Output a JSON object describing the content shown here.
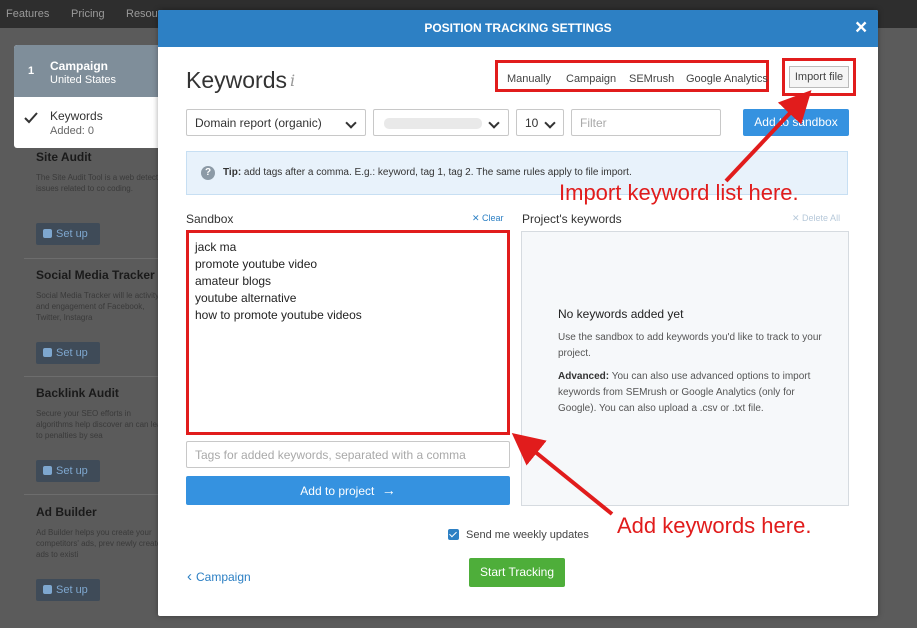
{
  "topnav": [
    "Features",
    "Pricing",
    "Resou"
  ],
  "steps": [
    {
      "num": "1",
      "title": "Campaign",
      "sub": "United States"
    },
    {
      "title": "Keywords",
      "sub": "Added: 0"
    }
  ],
  "tools": [
    {
      "title": "Site Audit",
      "desc": "The Site Audit Tool is a web detects issues related to co coding.",
      "setup": "Set up"
    },
    {
      "title": "Social Media Tracker",
      "desc": "Social Media Tracker will le activity and engagement of Facebook, Twitter, Instagra",
      "setup": "Set up"
    },
    {
      "title": "Backlink Audit",
      "desc": "Secure your SEO efforts in algorithms help discover an can lead to penalties by sea",
      "setup": "Set up"
    },
    {
      "title": "Ad Builder",
      "desc": "Ad Builder helps you create your competitors' ads, prev newly created ads to existi",
      "setup": "Set up"
    }
  ],
  "modal": {
    "title": "POSITION TRACKING SETTINGS",
    "close": "×",
    "heading": "Keywords",
    "info": "i",
    "sources": [
      "Manually",
      "Campaign",
      "SEMrush",
      "Google Analytics"
    ],
    "import_file": "Import file",
    "report_select": "Domain report (organic)",
    "count_select": "10",
    "filter_placeholder": "Filter",
    "add_sandbox": "Add to sandbox",
    "tip_label": "Tip:",
    "tip_text": " add tags after a comma. E.g.: keyword, tag 1, tag 2. The same rules apply to file import.",
    "sandbox_label": "Sandbox",
    "clear": "✕ Clear",
    "sandbox_keywords": [
      "jack ma",
      "promote youtube video",
      "amateur blogs",
      "youtube alternative",
      "how to promote youtube videos"
    ],
    "tags_placeholder": "Tags for added keywords, separated with a comma",
    "add_project": "Add to project",
    "add_project_arrow": "→",
    "project_label": "Project's keywords",
    "delete_all": "✕ Delete All",
    "empty_title": "No keywords added yet",
    "empty_desc": "Use the sandbox to add keywords you'd like to track to your project.",
    "advanced_label": "Advanced:",
    "advanced_text": " You can also use advanced options to import keywords from SEMrush or Google Analytics (only for Google). You can also upload a .csv or .txt file.",
    "weekly": "Send me weekly updates",
    "back": "Campaign",
    "back_icon": "‹",
    "start": "Start Tracking"
  },
  "annotations": {
    "import": "Import keyword list here.",
    "add": "Add keywords here."
  },
  "colors": {
    "header": "#2d80c4",
    "primary": "#3592e0",
    "success": "#4eae3a",
    "annotation": "#e11c1c"
  }
}
